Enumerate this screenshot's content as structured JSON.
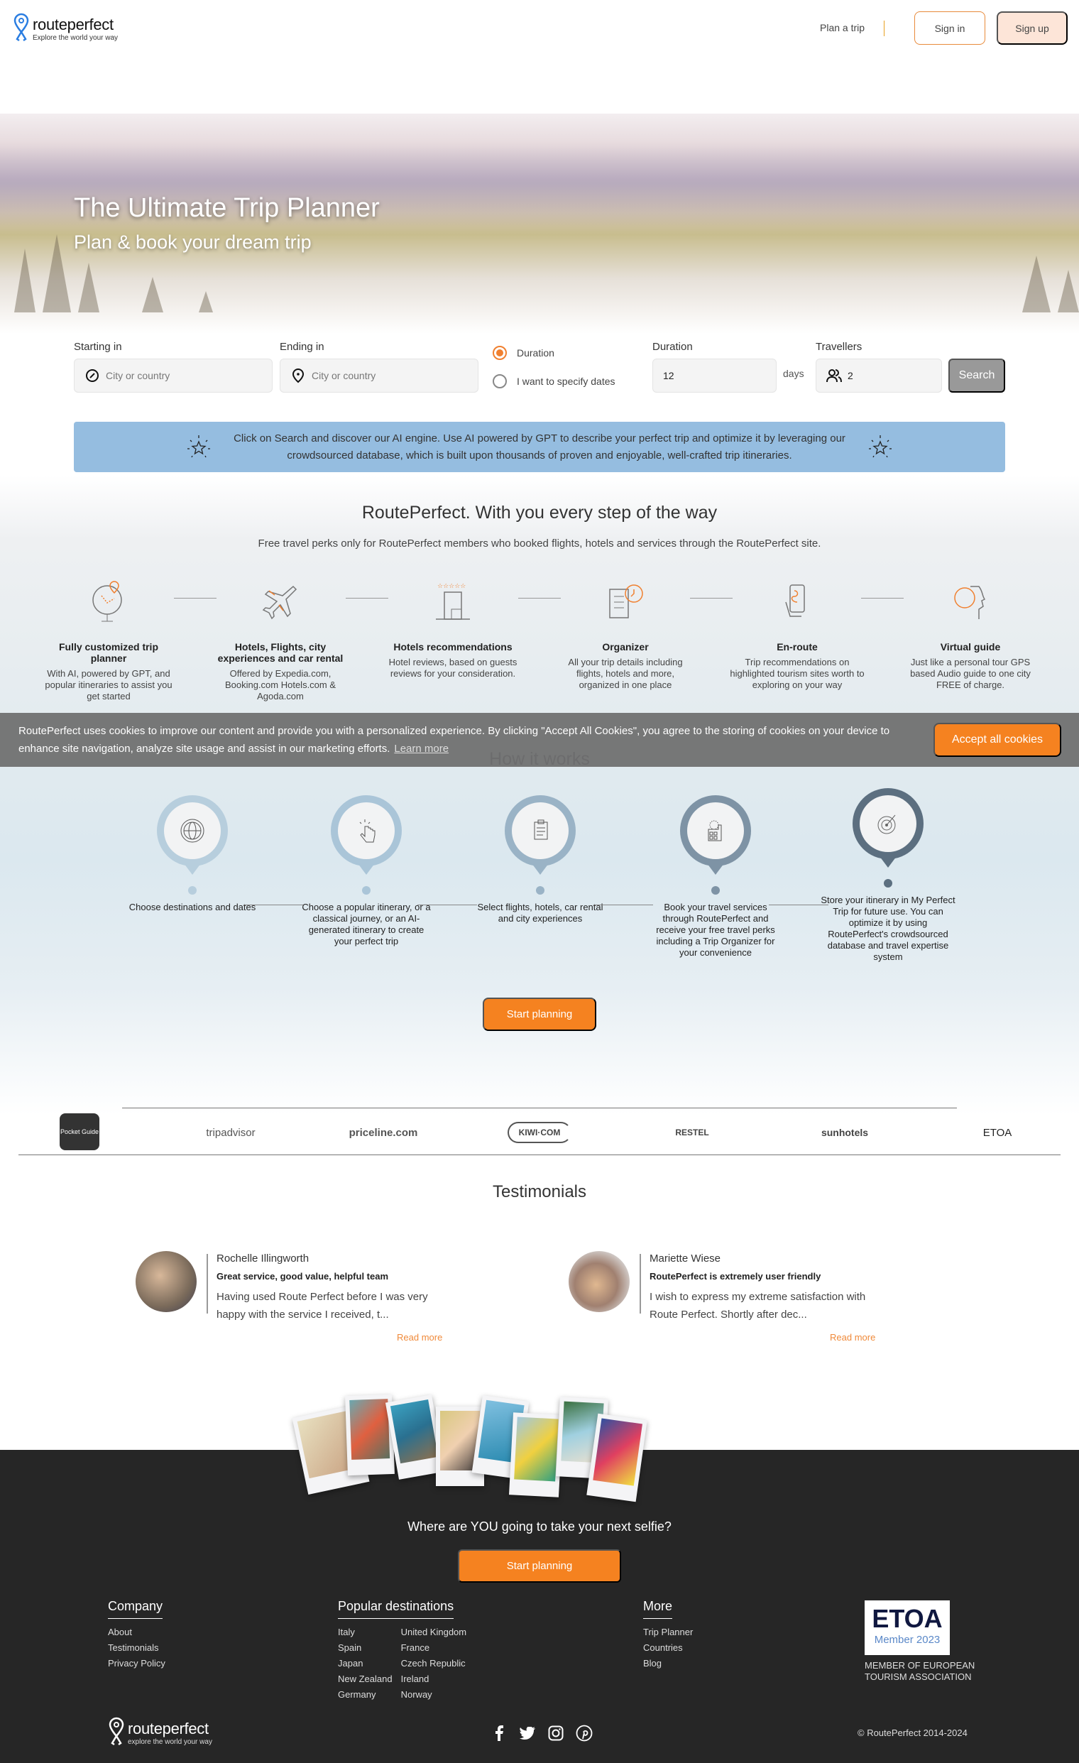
{
  "header": {
    "logo_name": "routeperfect",
    "logo_tagline": "Explore the world your way",
    "nav_plan_trip": "Plan a trip",
    "sign_in": "Sign in",
    "sign_up": "Sign up"
  },
  "hero": {
    "title": "The Ultimate Trip Planner",
    "subtitle": "Plan & book your dream trip"
  },
  "search": {
    "starting_label": "Starting in",
    "starting_placeholder": "City or country",
    "ending_label": "Ending in",
    "ending_placeholder": "City or country",
    "radio_duration": "Duration",
    "radio_dates": "I want to specify dates",
    "radio_selected": "Duration",
    "duration_label": "Duration",
    "duration_value": "12",
    "days_label": "days",
    "travellers_label": "Travellers",
    "travellers_value": "2",
    "search_button": "Search"
  },
  "ai_banner": {
    "text": "Click on Search and discover our AI engine. Use AI powered by GPT to describe your perfect trip and optimize it by leveraging our crowdsourced database, which is built upon thousands of proven and enjoyable, well-crafted trip itineraries."
  },
  "perks": {
    "title": "RoutePerfect. With you every step of the way",
    "subtitle": "Free travel perks only for RoutePerfect members who booked flights, hotels and services through the RoutePerfect site.",
    "items": [
      {
        "icon": "globe-pin-icon",
        "title": "Fully customized trip planner",
        "desc": "With AI, powered by GPT, and popular itineraries to assist you get started"
      },
      {
        "icon": "airplane-icon",
        "title": "Hotels, Flights, city experiences and car rental",
        "desc": "Offered by Expedia.com, Booking.com Hotels.com & Agoda.com"
      },
      {
        "icon": "hotel-icon",
        "title": "Hotels recommendations",
        "desc": "Hotel reviews, based on guests reviews for your consideration."
      },
      {
        "icon": "checklist-clock-icon",
        "title": "Organizer",
        "desc": "All your trip details including flights, hotels and more, organized in one place"
      },
      {
        "icon": "phone-route-icon",
        "title": "En-route",
        "desc": "Trip recommendations on highlighted tourism sites worth to exploring on your way"
      },
      {
        "icon": "speaking-head-icon",
        "title": "Virtual guide",
        "desc": "Just like a personal tour GPS based Audio guide to one city FREE of charge."
      }
    ]
  },
  "cookie": {
    "text": "RoutePerfect uses cookies to improve our content and provide you with a personalized experience. By clicking \"Accept All Cookies\", you agree to the storing of cookies on your device to enhance site navigation, analyze site usage and assist in our marketing efforts.",
    "learn_more": "Learn more",
    "accept": "Accept all cookies"
  },
  "how_it_works": {
    "title": "How it works",
    "steps": [
      {
        "icon": "globe-icon",
        "text": "Choose destinations and dates"
      },
      {
        "icon": "tap-hand-icon",
        "text": "Choose a popular itinerary, or a classical journey, or an AI-generated itinerary to create your perfect trip"
      },
      {
        "icon": "clipboard-icon",
        "text": "Select flights, hotels, car rental and city experiences"
      },
      {
        "icon": "building-icon",
        "text": "Book your travel services through RoutePerfect and receive your free travel perks including a Trip Organizer for your convenience"
      },
      {
        "icon": "target-icon",
        "text": "Store your itinerary in My Perfect Trip for future use. You can optimize it by using RoutePerfect's crowdsourced database and travel expertise system"
      }
    ],
    "start_button": "Start planning"
  },
  "partners": [
    "Pocket Guide",
    "tripadvisor",
    "priceline.com",
    "KIWI·COM",
    "RESTEL",
    "sunhotels",
    "ETOA"
  ],
  "testimonials": {
    "title": "Testimonials",
    "items": [
      {
        "name": "Rochelle Illingworth",
        "headline": "Great service, good value, helpful team",
        "body": "Having used Route Perfect before I was very happy with the service I received, t...",
        "read_more": "Read more"
      },
      {
        "name": "Mariette Wiese",
        "headline": "RoutePerfect is extremely user friendly",
        "body": "I wish to express my extreme satisfaction with Route Perfect. Shortly after dec...",
        "read_more": "Read more"
      }
    ]
  },
  "footer": {
    "selfie_text": "Where are YOU going to take your next selfie?",
    "start_button": "Start planning",
    "company_title": "Company",
    "company_links": [
      "About",
      "Testimonials",
      "Privacy Policy"
    ],
    "destinations_title": "Popular destinations",
    "destinations_col1": [
      "Italy",
      "Spain",
      "Japan",
      "New Zealand",
      "Germany"
    ],
    "destinations_col2": [
      "United Kingdom",
      "France",
      "Czech Republic",
      "Ireland",
      "Norway"
    ],
    "more_title": "More",
    "more_links": [
      "Trip Planner",
      "Countries",
      "Blog"
    ],
    "etoa_logo": "ETOA",
    "etoa_member": "Member 2023",
    "etoa_caption": "MEMBER OF EUROPEAN TOURISM ASSOCIATION",
    "logo_name": "routeperfect",
    "logo_tagline": "explore the world your way",
    "social": [
      "facebook-icon",
      "twitter-icon",
      "instagram-icon",
      "pinterest-icon"
    ],
    "copyright": "© RoutePerfect 2014-2024"
  },
  "colors": {
    "accent": "#f58220",
    "banner": "#95bde0",
    "footer_bg": "#262626"
  }
}
